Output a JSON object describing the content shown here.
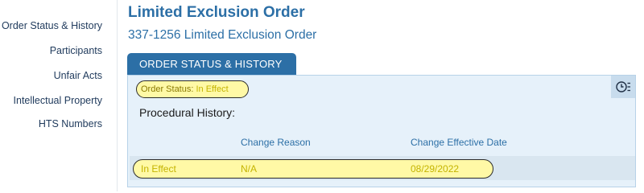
{
  "sidebar": {
    "items": [
      {
        "label": "Order Status & History"
      },
      {
        "label": "Participants"
      },
      {
        "label": "Unfair Acts"
      },
      {
        "label": "Intellectual Property"
      },
      {
        "label": "HTS Numbers"
      }
    ]
  },
  "header": {
    "title": "Limited Exclusion Order",
    "subtitle": "337-1256 Limited Exclusion Order"
  },
  "tab": {
    "label": "ORDER STATUS & HISTORY"
  },
  "panel": {
    "order_status_label": "Order Status:",
    "order_status_value": "In Effect",
    "history_icon": "history-clock-icon",
    "procedural_history_label": "Procedural History:",
    "columns": [
      "Change Reason",
      "Change Effective Date"
    ],
    "rows": [
      {
        "status": "In Effect",
        "change_reason": "N/A",
        "change_effective_date": "08/29/2022"
      }
    ]
  },
  "colors": {
    "brand": "#2c6fa6",
    "panel_bg": "#e6f1fa",
    "highlight": "#fff9a6"
  }
}
